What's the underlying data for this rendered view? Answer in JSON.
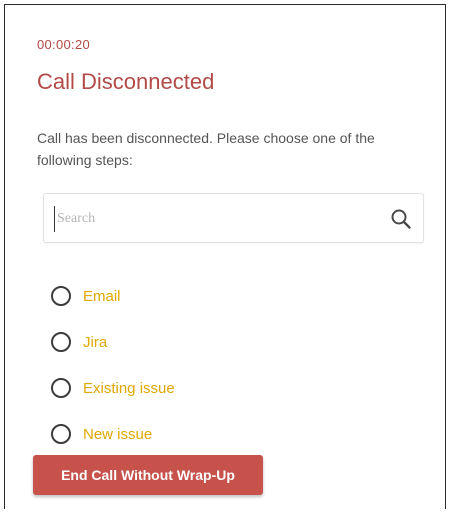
{
  "call": {
    "timer": "00:00:20",
    "title": "Call Disconnected",
    "description": "Call has been disconnected. Please choose one of the following steps:"
  },
  "search": {
    "placeholder": "Search",
    "value": "",
    "icon": "search-icon"
  },
  "options": [
    {
      "label": "Email",
      "selected": false
    },
    {
      "label": "Jira",
      "selected": false
    },
    {
      "label": "Existing issue",
      "selected": false
    },
    {
      "label": "New issue",
      "selected": false
    }
  ],
  "actions": {
    "end_call_label": "End Call Without Wrap-Up"
  },
  "colors": {
    "accent": "#b24a47",
    "option_text": "#e0a700",
    "button_bg": "#c6524b"
  }
}
